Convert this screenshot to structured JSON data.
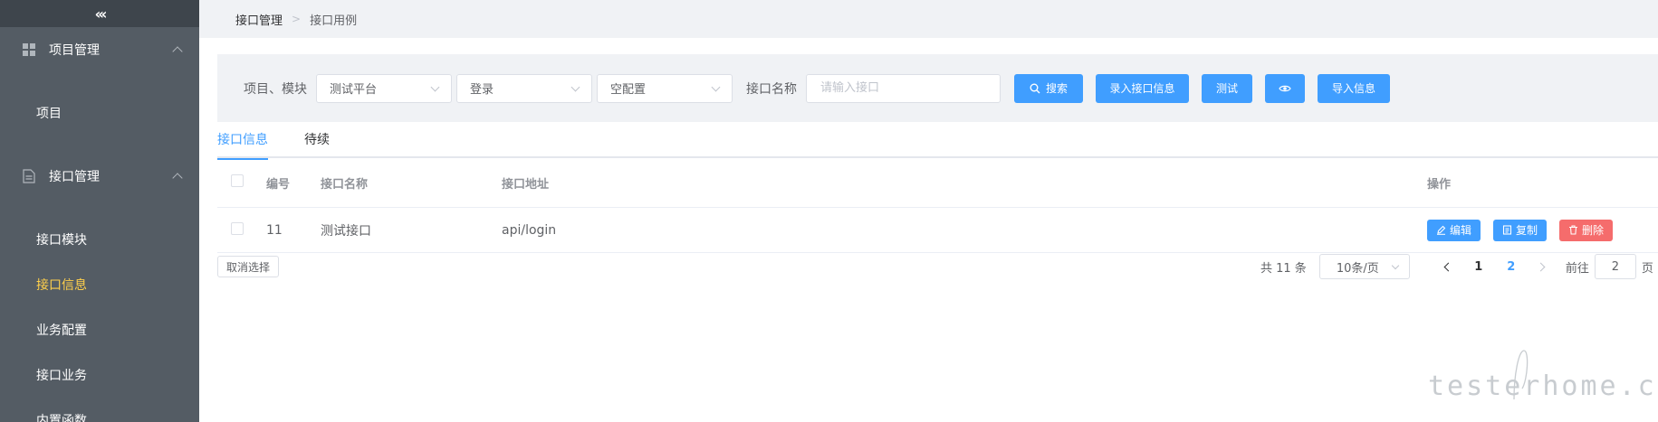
{
  "sidebar": {
    "groups": [
      {
        "label": "项目管理",
        "items": [
          "项目"
        ]
      },
      {
        "label": "接口管理",
        "items": [
          "接口模块",
          "接口信息",
          "业务配置",
          "接口业务",
          "内置函数"
        ]
      }
    ],
    "active_item": "接口信息"
  },
  "breadcrumb": {
    "level1": "接口管理",
    "level2": "接口用例"
  },
  "filter": {
    "project_module_label": "项目、模块",
    "project_select": "测试平台",
    "module_select": "登录",
    "config_select": "空配置",
    "api_name_label": "接口名称",
    "api_name_placeholder": "请输入接口",
    "search_button": "搜索",
    "add_button": "录入接口信息",
    "test_button": "测试",
    "import_button": "导入信息"
  },
  "tabs": [
    {
      "label": "接口信息",
      "active": true
    },
    {
      "label": "待续",
      "active": false
    }
  ],
  "table": {
    "columns": {
      "id": "编号",
      "name": "接口名称",
      "url": "接口地址",
      "ops": "操作"
    },
    "rows": [
      {
        "id": "11",
        "name": "测试接口",
        "url": "api/login"
      }
    ],
    "ops": {
      "edit": "编辑",
      "copy": "复制",
      "delete": "删除"
    }
  },
  "footer": {
    "clear_selection": "取消选择",
    "total": "共 11 条",
    "page_size": "10条/页",
    "pages": [
      "1",
      "2"
    ],
    "current_page": "2",
    "goto_prefix": "前往",
    "goto_value": "2",
    "goto_suffix": "页"
  },
  "watermark": "testerhome.com",
  "colors": {
    "sidebar_bg": "#545c64",
    "active_menu": "#ffd04b",
    "primary": "#409eff",
    "danger": "#f56c6c"
  }
}
